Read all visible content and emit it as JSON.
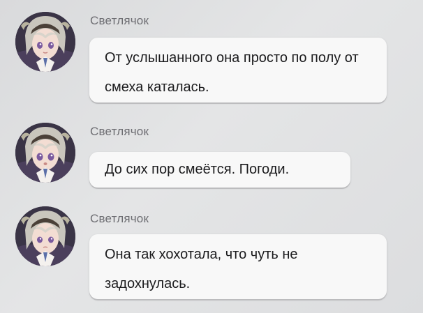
{
  "messages": [
    {
      "sender": "Светлячок",
      "text": "От услышанного она просто по полу от смеха каталась."
    },
    {
      "sender": "Светлячок",
      "text": "До сих пор смеётся. Погоди."
    },
    {
      "sender": "Светлячок",
      "text": "Она так хохотала, что чуть не задохнулась."
    }
  ],
  "colors": {
    "background": "#dedfe1",
    "bubble": "#f8f8f8",
    "sender_text": "#6d6d72",
    "message_text": "#1c1c1e"
  },
  "icons": {
    "avatar": "character-avatar-icon"
  }
}
